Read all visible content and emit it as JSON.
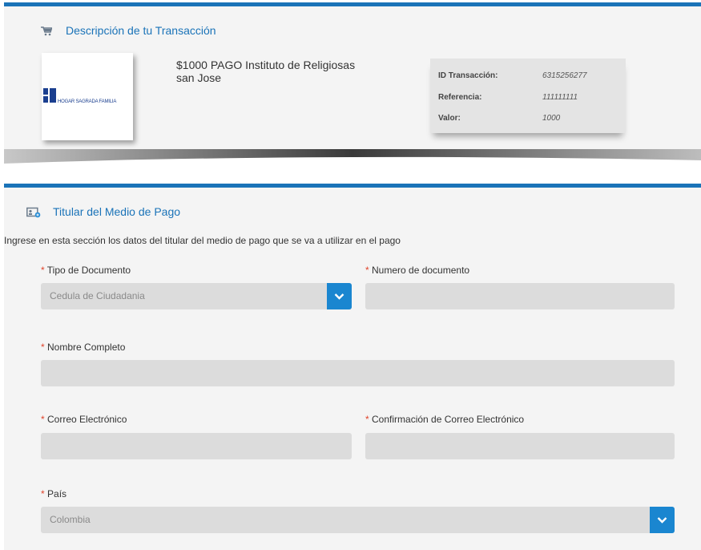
{
  "description": {
    "title": "Descripción de tu Transacción",
    "logo_text": "HOGAR SAGRADA FAMILIA",
    "logo_mark": "SF",
    "item_text": "$1000 PAGO Instituto de Religiosas san Jose",
    "ticket": [
      {
        "label": "ID Transacción:",
        "value": "6315256277"
      },
      {
        "label": "Referencia:",
        "value": "111111111"
      },
      {
        "label": "Valor:",
        "value": "1000"
      }
    ]
  },
  "titular": {
    "title": "Titular del Medio de Pago",
    "intro": "Ingrese en esta sección los datos del titular del medio de pago que se va a utilizar en el pago",
    "required_mark": "*",
    "fields": {
      "doc_type": {
        "label": "Tipo de Documento",
        "value": "Cedula de Ciudadania"
      },
      "doc_number": {
        "label": "Numero de documento",
        "value": ""
      },
      "full_name": {
        "label": "Nombre Completo",
        "value": ""
      },
      "email": {
        "label": "Correo Electrónico",
        "value": ""
      },
      "email_confirm": {
        "label": "Confirmación de Correo Electrónico",
        "value": ""
      },
      "country": {
        "label": "País",
        "value": "Colombia"
      }
    }
  },
  "icons": {
    "cart": "cart-icon",
    "id_card": "id-card-icon",
    "dropdown": "chevron-down-icon"
  },
  "colors": {
    "accent": "#1a73b8",
    "dropdown_button": "#1a86d0",
    "required": "#e0432b",
    "panel_bg": "#f4f4f4",
    "field_bg": "#dcdcdc"
  }
}
